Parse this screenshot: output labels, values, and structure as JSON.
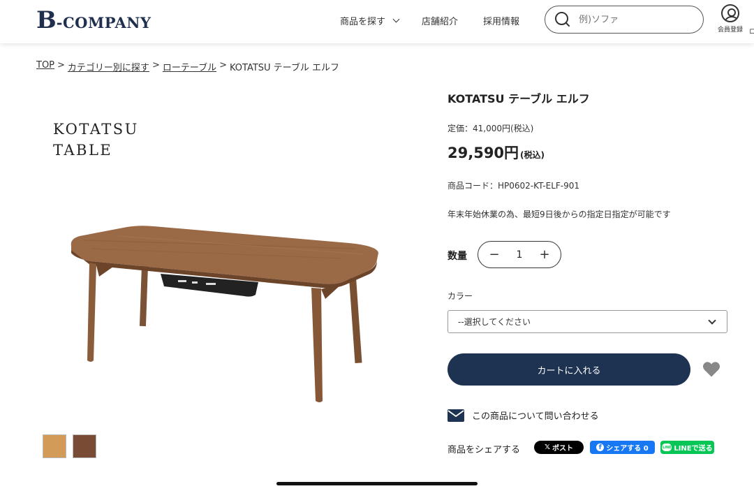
{
  "header": {
    "logo_b": "B",
    "logo_rest": "-COMPANY",
    "nav": [
      {
        "label": "商品を探す",
        "has_dropdown": true
      },
      {
        "label": "店舗紹介"
      },
      {
        "label": "採用情報"
      }
    ],
    "search_placeholder": "例)ソファ",
    "member_label": "会員登録",
    "edge_char": "ロ"
  },
  "breadcrumb": {
    "items": [
      "TOP",
      "カテゴリー別に探す",
      "ローテーブル"
    ],
    "separator": ">",
    "current": "KOTATSU テーブル エルフ"
  },
  "gallery": {
    "title_line1": "KOTATSU",
    "title_line2": "TABLE",
    "swatch_colors": [
      "#d39b58",
      "#7a4b34"
    ]
  },
  "product": {
    "name": "KOTATSU テーブル エルフ",
    "list_price": "定価：41,000円(税込)",
    "price": "29,590円",
    "price_tax": "(税込)",
    "code": "商品コード：HP0602-KT-ELF-901",
    "delivery_notice": "年末年始休業の為、最短9日後からの指定日指定が可能です",
    "quantity_label": "数量",
    "quantity": "1",
    "minus": "−",
    "plus": "+",
    "color_label": "カラー",
    "color_select": "--選択してください",
    "cart_button": "カートに入れる",
    "contact_label": "この商品について問い合わせる",
    "share_label": "商品をシェアする",
    "share": {
      "x": "ポスト",
      "x_icon": "𝕏",
      "fb": "シェアする 0",
      "fb_icon": "f",
      "line": "LINEで送る",
      "line_icon": "LINE"
    }
  },
  "colors": {
    "brand": "#1f2f4d",
    "cart": "#1e3352",
    "facebook": "#1877f2",
    "line": "#06c755"
  }
}
